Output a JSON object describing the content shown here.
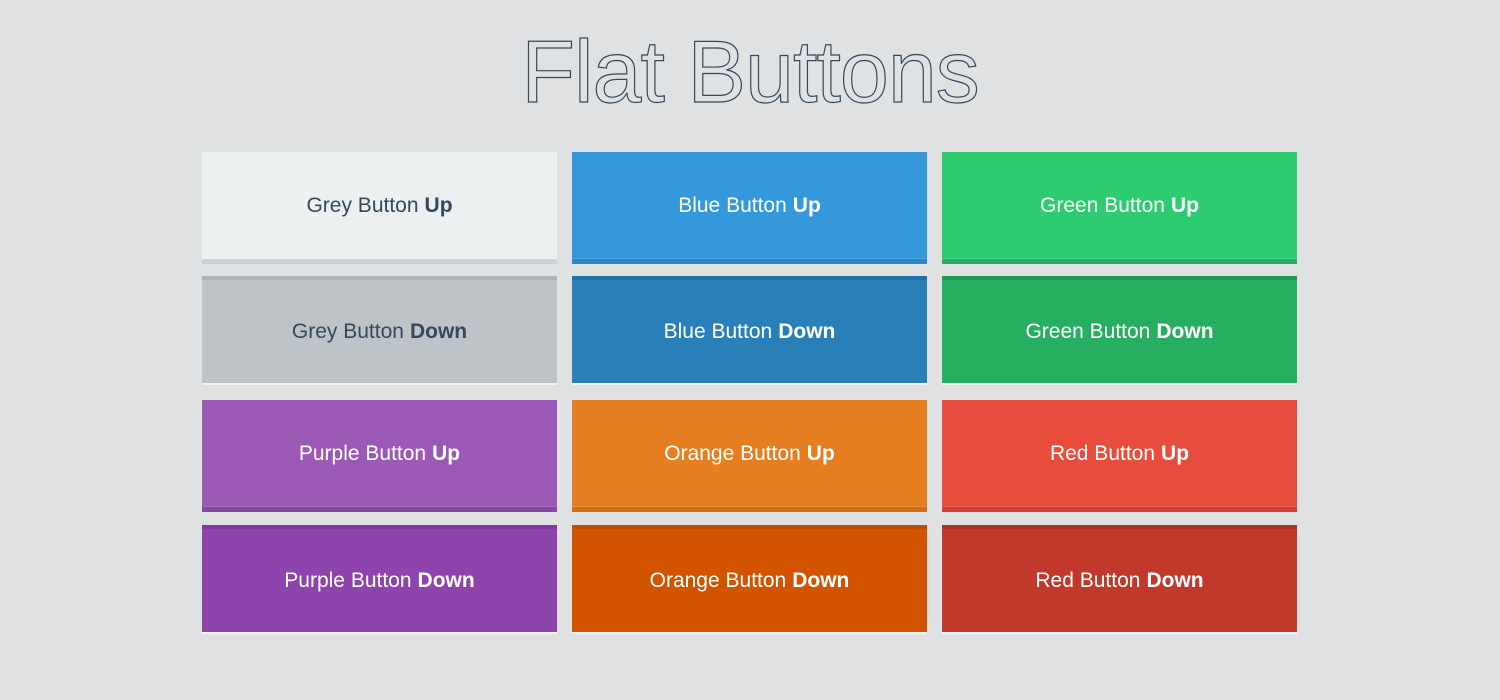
{
  "page": {
    "title": "Flat Buttons"
  },
  "buttons": [
    {
      "id": "grey-up",
      "label": "Grey Button",
      "state": "Up",
      "color": "#ecf0f1",
      "text_color": "#34495e"
    },
    {
      "id": "blue-up",
      "label": "Blue Button",
      "state": "Up",
      "color": "#3498db",
      "text_color": "#ffffff"
    },
    {
      "id": "green-up",
      "label": "Green Button",
      "state": "Up",
      "color": "#2ecc71",
      "text_color": "#ffffff"
    },
    {
      "id": "grey-down",
      "label": "Grey Button",
      "state": "Down",
      "color": "#bdc3c7",
      "text_color": "#34495e"
    },
    {
      "id": "blue-down",
      "label": "Blue Button",
      "state": "Down",
      "color": "#2980b9",
      "text_color": "#ffffff"
    },
    {
      "id": "green-down",
      "label": "Green Button",
      "state": "Down",
      "color": "#27ae60",
      "text_color": "#ffffff"
    },
    {
      "id": "purple-up",
      "label": "Purple Button",
      "state": "Up",
      "color": "#9b59b6",
      "text_color": "#ffffff"
    },
    {
      "id": "orange-up",
      "label": "Orange Button",
      "state": "Up",
      "color": "#e67e22",
      "text_color": "#ffffff"
    },
    {
      "id": "red-up",
      "label": "Red Button",
      "state": "Up",
      "color": "#e74c3c",
      "text_color": "#ffffff"
    },
    {
      "id": "purple-down",
      "label": "Purple Button",
      "state": "Down",
      "color": "#8e44ad",
      "text_color": "#ffffff"
    },
    {
      "id": "orange-down",
      "label": "Orange Button",
      "state": "Down",
      "color": "#d35400",
      "text_color": "#ffffff"
    },
    {
      "id": "red-down",
      "label": "Red Button",
      "state": "Down",
      "color": "#c0392b",
      "text_color": "#ffffff"
    }
  ],
  "colors": {
    "background": "#dfe1e2",
    "title": "#34495e"
  }
}
